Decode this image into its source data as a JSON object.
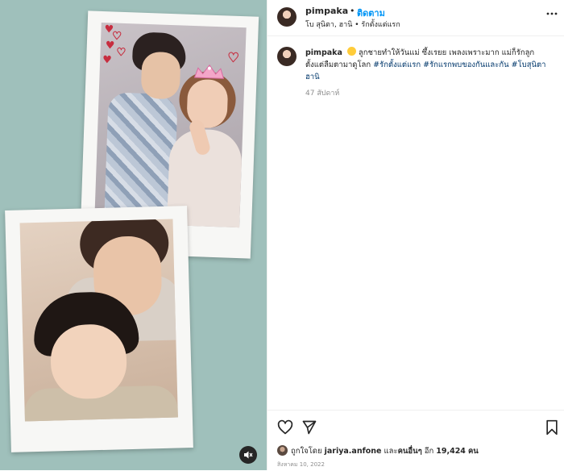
{
  "header": {
    "username": "pimpaka",
    "dot": "•",
    "follow_label": "ติดตาม",
    "location": "โบ สุนิตา, ฮานิ • รักตั้งแต่แรก"
  },
  "caption": {
    "username": "pimpaka",
    "text_part1": "ลูกชายทำให้วันแม่ ซึ้งเรยย เพลงเพราะมาก แม่ก็รักลูกตั้งแต่ลืมตามาดูโลก",
    "hashtags": [
      "#รักตั้งแต่แรก",
      "#รักแรกพบของกันและกัน",
      "#โบสุนิตาฮานิ"
    ],
    "time_ago": "47 สัปดาห์"
  },
  "likes": {
    "prefix": "ถูกใจโดย",
    "user": "jariya.anfone",
    "connector": "และ",
    "others_label": "คนอื่นๆ",
    "others_prefix": "อีก",
    "count": "19,424",
    "unit": "คน"
  },
  "date": "สิงหาคม 10, 2022",
  "icons": {
    "more": "more-horizontal-icon",
    "like": "heart-icon",
    "share": "paper-plane-icon",
    "save": "bookmark-icon",
    "mute": "speaker-muted-icon"
  },
  "colors": {
    "media_background": "#9fc0bb",
    "follow_blue": "#0095f6",
    "hashtag_blue": "#00376b",
    "text": "#262626",
    "muted_text": "#8e8e8e"
  }
}
